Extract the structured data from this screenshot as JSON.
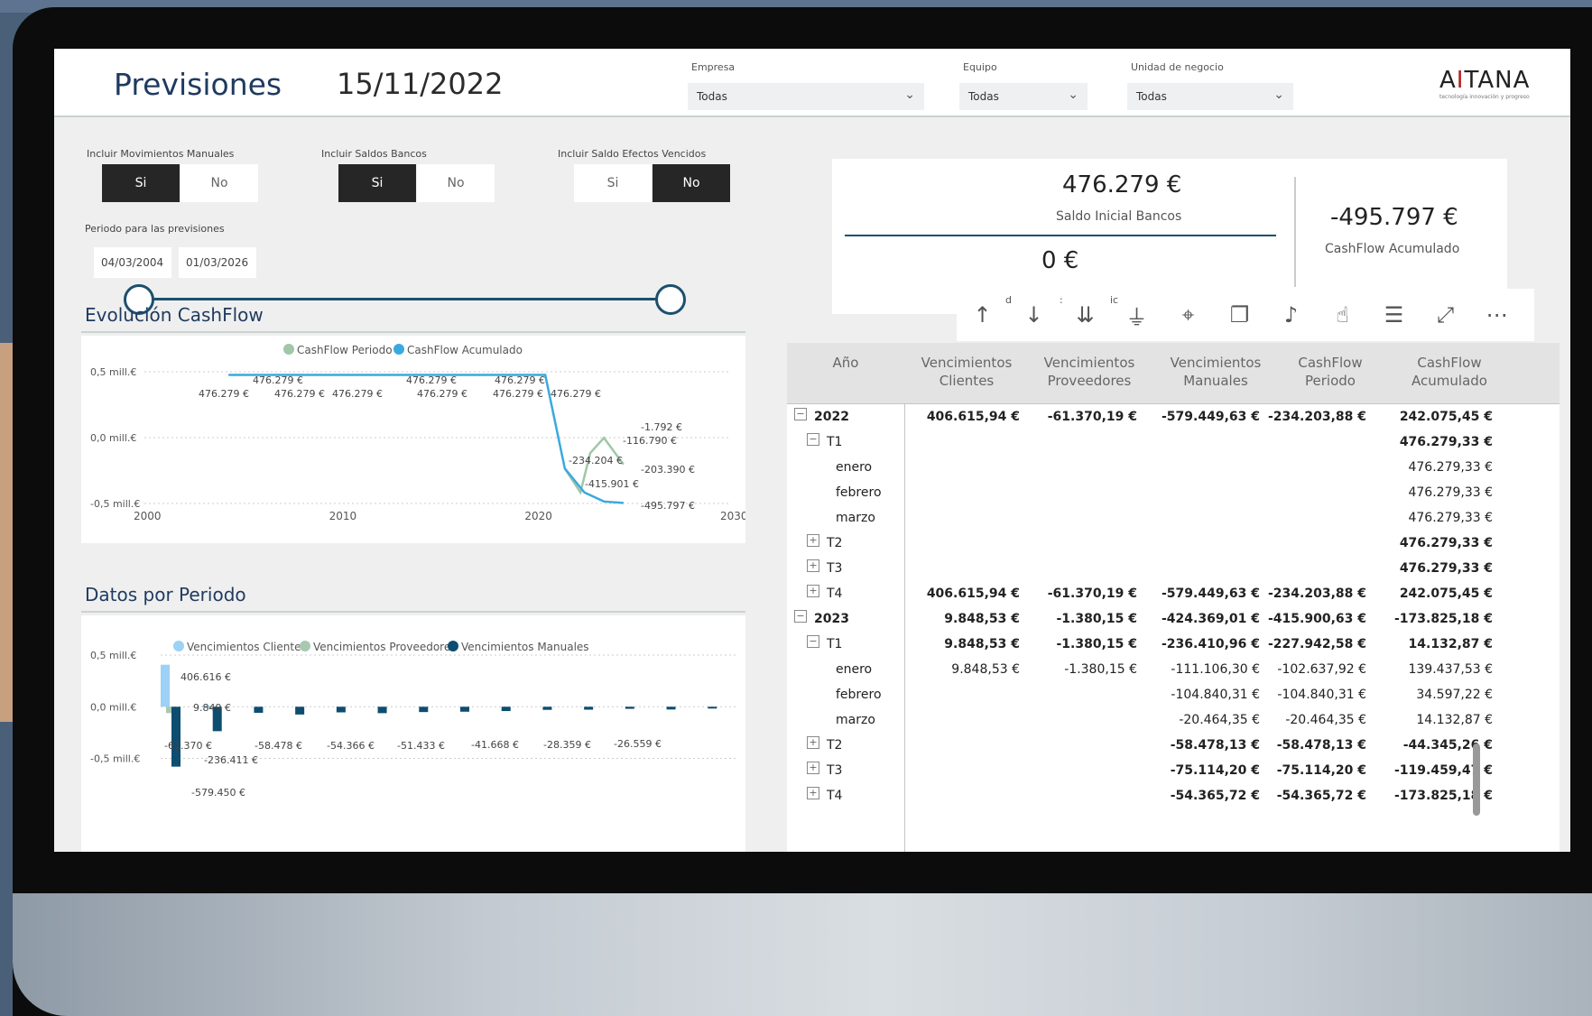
{
  "header": {
    "title": "Previsiones",
    "date": "15/11/2022",
    "filters": [
      {
        "label": "Empresa",
        "value": "Todas"
      },
      {
        "label": "Equipo",
        "value": "Todas"
      },
      {
        "label": "Unidad de negocio",
        "value": "Todas"
      }
    ],
    "logo": "AITANA",
    "logo_sub": "tecnología innovación y progreso"
  },
  "controls": {
    "manual": {
      "label": "Incluir Movimientos Manuales",
      "yes": "Si",
      "no": "No",
      "selected": "Si"
    },
    "banks": {
      "label": "Incluir Saldos Bancos",
      "yes": "Si",
      "no": "No",
      "selected": "Si"
    },
    "effects": {
      "label": "Incluir Saldo Efectos Vencidos",
      "yes": "Si",
      "no": "No",
      "selected": "No"
    },
    "period_label": "Periodo para las previsiones",
    "date_from": "04/03/2004",
    "date_to": "01/03/2026"
  },
  "kpis": {
    "saldo_value": "476.279 €",
    "saldo_label": "Saldo Inicial Bancos",
    "zero_value": "0 €",
    "cashflow_value": "-495.797 €",
    "cashflow_label": "CashFlow Acumulado"
  },
  "toolbar": {
    "icons": [
      "sort-ascending-icon",
      "sort-descending-icon",
      "expand-all-icon",
      "hierarchy-icon",
      "pin-icon",
      "copy-icon",
      "bell-icon",
      "like-icon",
      "filter-icon",
      "focus-mode-icon",
      "more-options-icon"
    ],
    "stub1": "d",
    "stub2": ":",
    "stub3": "ic"
  },
  "charts": {
    "evolucion_title": "Evolución CashFlow",
    "datos_title": "Datos por Periodo"
  },
  "chart_data": [
    {
      "type": "line",
      "title": "Evolución CashFlow",
      "legend_position": "top",
      "series": [
        {
          "name": "CashFlow Periodo",
          "color": "#9fc7a8",
          "x": [
            2021.5,
            2022.3,
            2022.8,
            2023.5,
            2024.5
          ],
          "y": [
            -234204,
            -415901,
            -116790,
            -1792,
            -203390
          ]
        },
        {
          "name": "CashFlow Acumulado",
          "color": "#3aa9de",
          "x": [
            2004.3,
            2006,
            2008,
            2010,
            2012,
            2014,
            2016,
            2018,
            2019.5,
            2020.5,
            2021.5,
            2022.5,
            2023.5,
            2024.5
          ],
          "y": [
            476279,
            476279,
            476279,
            476279,
            476279,
            476279,
            476279,
            476279,
            476279,
            476279,
            -234204,
            -415901,
            -485000,
            -495797
          ]
        }
      ],
      "xlim": [
        2000,
        2030
      ],
      "ylim": [
        -0.5,
        0.5
      ],
      "xticks": [
        "2000",
        "2010",
        "2020",
        "2030"
      ],
      "yticks": [
        "0,5 mill.€",
        "0,0 mill.€",
        "-0,5 mill.€"
      ],
      "labels": [
        "476.279 €",
        "476.279 €",
        "476.279 €",
        "476.279 €",
        "476.279 €",
        "476.279 €",
        "476.279 €",
        "476.279 €",
        "476.279 €",
        "-1.792 €",
        "-116.790 €",
        "-234.204 €",
        "-203.390 €",
        "-415.901 €",
        "-495.797 €"
      ]
    },
    {
      "type": "bar",
      "title": "Datos por Periodo",
      "legend_position": "top",
      "series": [
        {
          "name": "Vencimientos Clientes",
          "color": "#9dd1f5",
          "values": [
            406616,
            9849,
            0,
            0,
            0,
            0,
            0,
            0,
            0,
            0,
            0,
            0,
            0,
            0
          ]
        },
        {
          "name": "Vencimientos Proveedores",
          "color": "#a8c8b0",
          "values": [
            -61370,
            -1380,
            0,
            0,
            0,
            0,
            0,
            0,
            0,
            0,
            0,
            0,
            0,
            0
          ]
        },
        {
          "name": "Vencimientos Manuales",
          "color": "#0d4d70",
          "values": [
            -579450,
            -236411,
            -58478,
            -75114,
            -54366,
            -62000,
            -51433,
            -48000,
            -41668,
            -30000,
            -28359,
            -20000,
            -26559,
            -10000
          ]
        }
      ],
      "ylim": [
        -0.6,
        0.5
      ],
      "yticks": [
        "0,5 mill.€",
        "0,0 mill.€",
        "-0,5 mill.€"
      ],
      "labels": [
        "406.616 €",
        "9.849 €",
        "-61.370 €",
        "-236.411 €",
        "-58.478 €",
        "-54.366 €",
        "-51.433 €",
        "-41.668 €",
        "-28.359 €",
        "-26.559 €",
        "-579.450 €"
      ]
    }
  ],
  "table": {
    "headers": [
      "Año",
      "Vencimientos Clientes",
      "Vencimientos Proveedores",
      "Vencimientos Manuales",
      "CashFlow Periodo",
      "CashFlow Acumulado"
    ],
    "rows": [
      {
        "label": "2022",
        "level": 0,
        "exp": "⊟",
        "bold": true,
        "cells": [
          "406.615,94 €",
          "-61.370,19 €",
          "-579.449,63 €",
          "-234.203,88 €",
          "242.075,45 €"
        ]
      },
      {
        "label": "T1",
        "level": 1,
        "exp": "⊟",
        "bold": true,
        "cells": [
          "",
          "",
          "",
          "",
          "476.279,33 €"
        ]
      },
      {
        "label": "enero",
        "level": 2,
        "exp": "",
        "bold": false,
        "cells": [
          "",
          "",
          "",
          "",
          "476.279,33 €"
        ]
      },
      {
        "label": "febrero",
        "level": 2,
        "exp": "",
        "bold": false,
        "cells": [
          "",
          "",
          "",
          "",
          "476.279,33 €"
        ]
      },
      {
        "label": "marzo",
        "level": 2,
        "exp": "",
        "bold": false,
        "cells": [
          "",
          "",
          "",
          "",
          "476.279,33 €"
        ]
      },
      {
        "label": "T2",
        "level": 1,
        "exp": "⊞",
        "bold": true,
        "cells": [
          "",
          "",
          "",
          "",
          "476.279,33 €"
        ]
      },
      {
        "label": "T3",
        "level": 1,
        "exp": "⊞",
        "bold": true,
        "cells": [
          "",
          "",
          "",
          "",
          "476.279,33 €"
        ]
      },
      {
        "label": "T4",
        "level": 1,
        "exp": "⊞",
        "bold": true,
        "cells": [
          "406.615,94 €",
          "-61.370,19 €",
          "-579.449,63 €",
          "-234.203,88 €",
          "242.075,45 €"
        ]
      },
      {
        "label": "2023",
        "level": 0,
        "exp": "⊟",
        "bold": true,
        "cells": [
          "9.848,53 €",
          "-1.380,15 €",
          "-424.369,01 €",
          "-415.900,63 €",
          "-173.825,18 €"
        ]
      },
      {
        "label": "T1",
        "level": 1,
        "exp": "⊟",
        "bold": true,
        "cells": [
          "9.848,53 €",
          "-1.380,15 €",
          "-236.410,96 €",
          "-227.942,58 €",
          "14.132,87 €"
        ]
      },
      {
        "label": "enero",
        "level": 2,
        "exp": "",
        "bold": false,
        "cells": [
          "9.848,53 €",
          "-1.380,15 €",
          "-111.106,30 €",
          "-102.637,92 €",
          "139.437,53 €"
        ]
      },
      {
        "label": "febrero",
        "level": 2,
        "exp": "",
        "bold": false,
        "cells": [
          "",
          "",
          "-104.840,31 €",
          "-104.840,31 €",
          "34.597,22 €"
        ]
      },
      {
        "label": "marzo",
        "level": 2,
        "exp": "",
        "bold": false,
        "cells": [
          "",
          "",
          "-20.464,35 €",
          "-20.464,35 €",
          "14.132,87 €"
        ]
      },
      {
        "label": "T2",
        "level": 1,
        "exp": "⊞",
        "bold": true,
        "cells": [
          "",
          "",
          "-58.478,13 €",
          "-58.478,13 €",
          "-44.345,26 €"
        ]
      },
      {
        "label": "T3",
        "level": 1,
        "exp": "⊞",
        "bold": true,
        "cells": [
          "",
          "",
          "-75.114,20 €",
          "-75.114,20 €",
          "-119.459,47 €"
        ]
      },
      {
        "label": "T4",
        "level": 1,
        "exp": "⊞",
        "bold": true,
        "cells": [
          "",
          "",
          "-54.365,72 €",
          "-54.365,72 €",
          "-173.825,18 €"
        ]
      }
    ]
  }
}
